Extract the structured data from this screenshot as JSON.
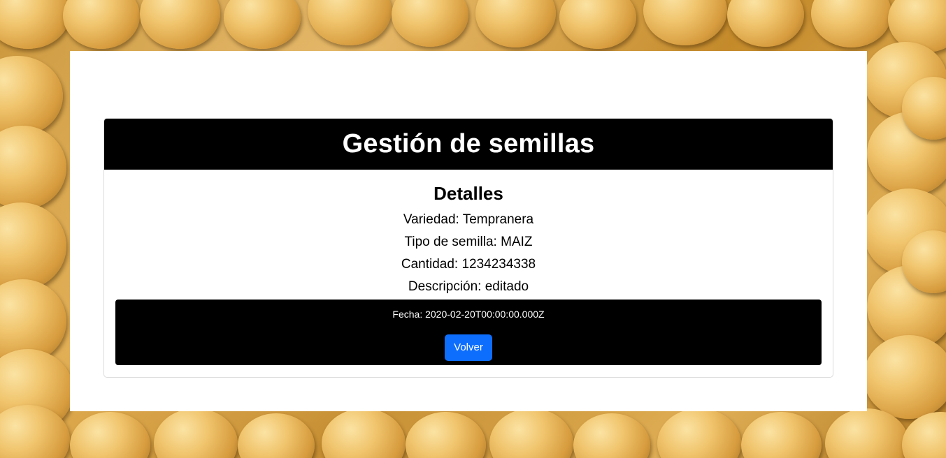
{
  "header": {
    "title": "Gestión de semillas"
  },
  "details": {
    "title": "Detalles",
    "variedad": "Variedad: Tempranera",
    "tipo": "Tipo de semilla: MAIZ",
    "cantidad": "Cantidad: 1234234338",
    "descripcion": "Descripción: editado"
  },
  "footer": {
    "fecha": "Fecha: 2020-02-20T00:00:00.000Z",
    "volver_label": "Volver"
  },
  "colors": {
    "header_bg": "#000000",
    "button_primary": "#0d6efd",
    "panel_bg": "#ffffff"
  }
}
